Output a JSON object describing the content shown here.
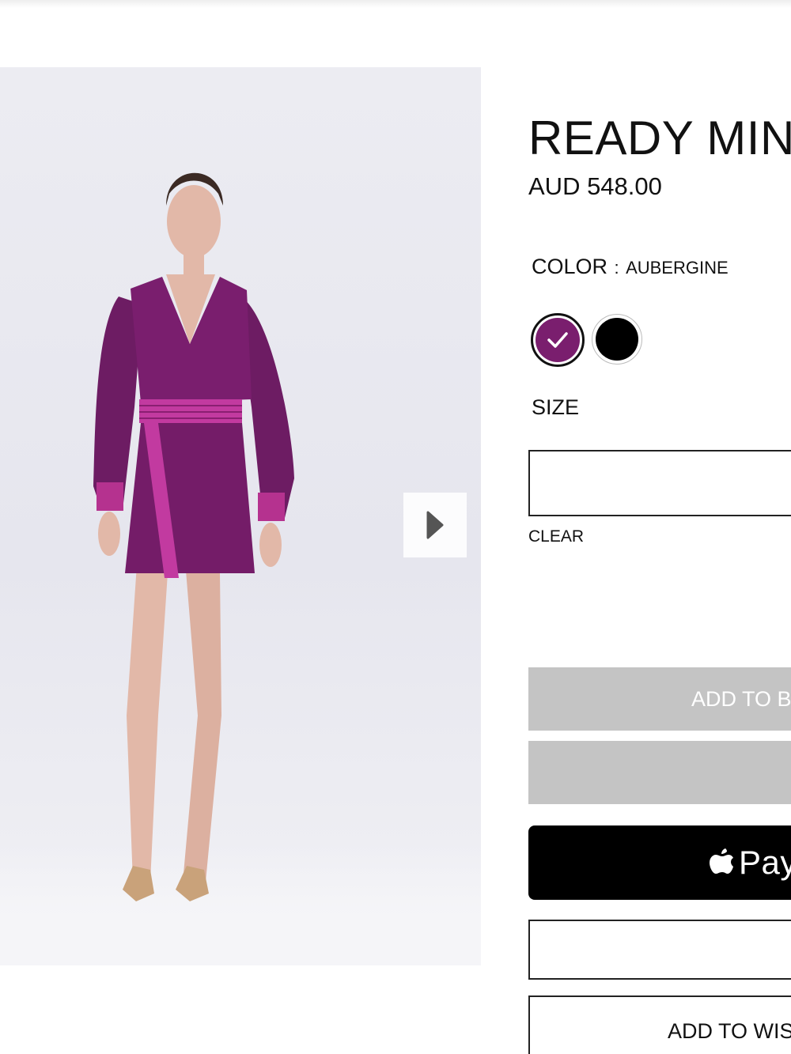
{
  "product": {
    "title": "READY MINI",
    "price": "AUD 548.00",
    "image_alt": "Model wearing aubergine mini dress with striped pink belt"
  },
  "color": {
    "label": "COLOR",
    "separator": ":",
    "value": "AUBERGINE",
    "swatches": [
      {
        "name": "aubergine",
        "hex": "#7a1e6e",
        "selected": true
      },
      {
        "name": "black",
        "hex": "#000000",
        "selected": false
      }
    ]
  },
  "size": {
    "label": "SIZE",
    "selected_value": "",
    "clear_label": "CLEAR"
  },
  "actions": {
    "add_to_bag_label": "ADD TO B",
    "apple_pay_label": "Pay",
    "add_to_wishlist_label": "ADD TO WIS"
  },
  "colors": {
    "disabled_button": "#c4c4c4",
    "dress": "#7a1e6e",
    "belt_accent": "#c23aa0"
  },
  "icons": {
    "gallery_next": "chevron-right-icon",
    "swatch_check": "check-icon",
    "apple_logo": "apple-icon"
  }
}
